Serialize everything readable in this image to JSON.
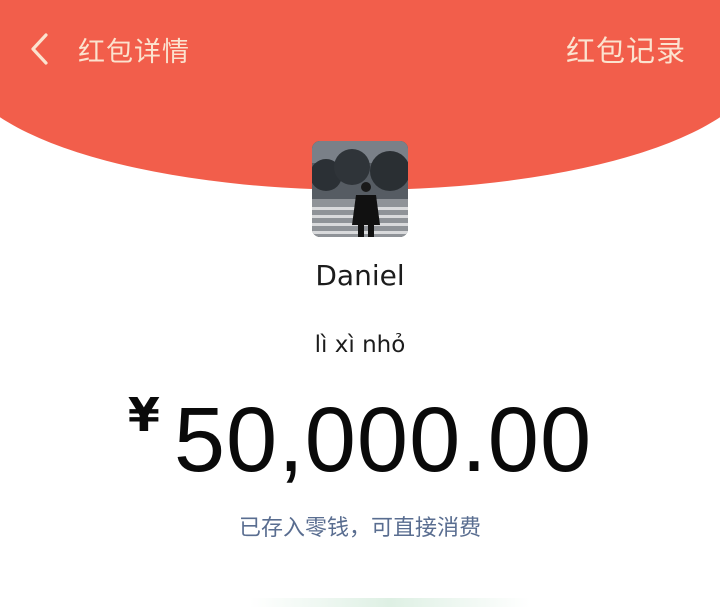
{
  "header": {
    "title": "红包详情",
    "record_link": "红包记录"
  },
  "sender": {
    "name": "Daniel"
  },
  "greeting": "lì xì nhỏ",
  "amount": {
    "currency": "¥",
    "value": "50,000.00"
  },
  "status": "已存入零钱，可直接消费",
  "colors": {
    "header_red": "#f25e4b",
    "header_text": "#fbe3cf",
    "status_link": "#596d90"
  },
  "icons": {
    "back": "chevron-left-icon"
  }
}
